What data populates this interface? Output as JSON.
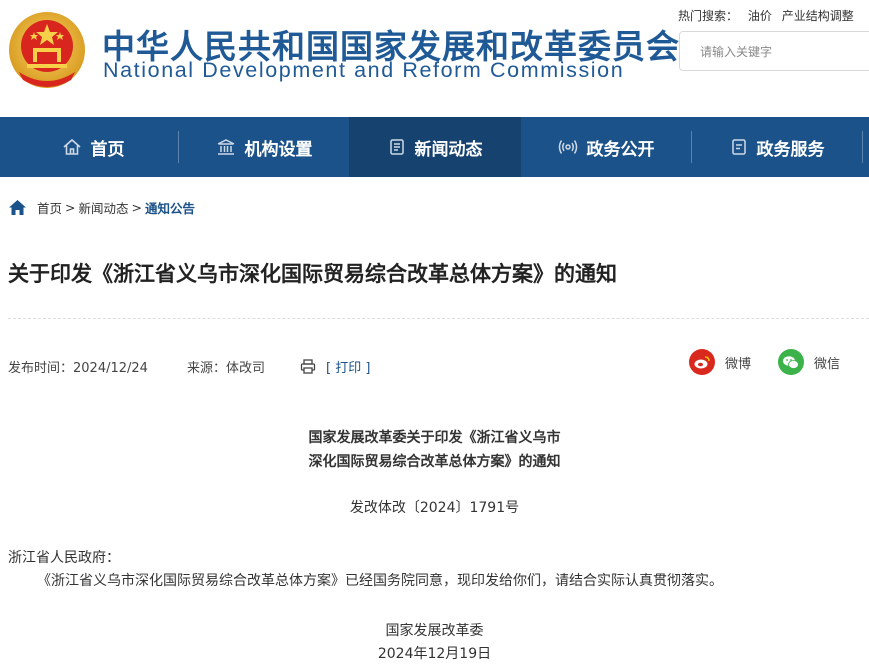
{
  "header": {
    "title_cn": "中华人民共和国国家发展和改革委员会",
    "title_en": "National Development and Reform Commission",
    "hot_search_label": "热门搜索：",
    "hot_search_items": [
      "油价",
      "产业结构调整"
    ],
    "search_placeholder": "请输入关键字"
  },
  "nav": {
    "items": [
      {
        "label": "首页",
        "icon": "home-icon"
      },
      {
        "label": "机构设置",
        "icon": "building-icon"
      },
      {
        "label": "新闻动态",
        "icon": "news-icon",
        "active": true
      },
      {
        "label": "政务公开",
        "icon": "broadcast-icon"
      },
      {
        "label": "政务服务",
        "icon": "document-icon"
      }
    ],
    "background": "#1b5289",
    "active_background": "#15426f"
  },
  "breadcrumb": {
    "items": [
      "首页",
      "新闻动态",
      "通知公告"
    ],
    "separator": ">"
  },
  "article": {
    "title": "关于印发《浙江省义乌市深化国际贸易综合改革总体方案》的通知",
    "publish_time": "发布时间：2024/12/24",
    "source": "来源：体改司",
    "print_label": "[ 打印 ]",
    "share": {
      "weibo": "微博",
      "wechat": "微信"
    }
  },
  "content": {
    "heading_line1": "国家发展改革委关于印发《浙江省义乌市",
    "heading_line2": "深化国际贸易综合改革总体方案》的通知",
    "doc_number": "发改体改〔2024〕1791号",
    "addressee": "浙江省人民政府：",
    "body": "《浙江省义乌市深化国际贸易综合改革总体方案》已经国务院同意，现印发给你们，请结合实际认真贯彻落实。",
    "sign_org": "国家发展改革委",
    "sign_date": "2024年12月19日"
  }
}
